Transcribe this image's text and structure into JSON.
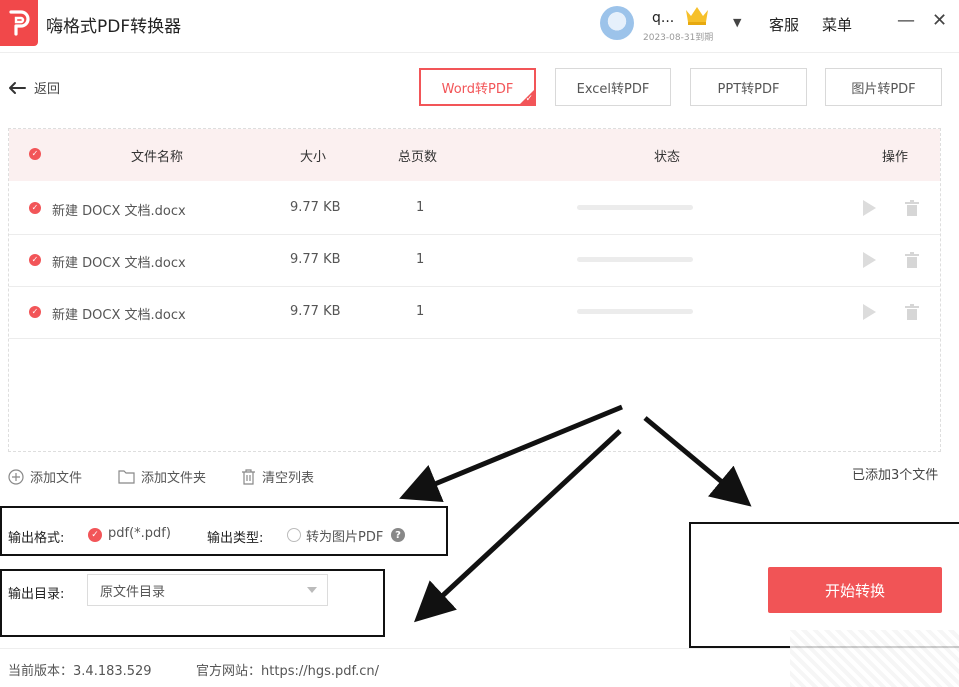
{
  "app": {
    "title": "嗨格式PDF转换器",
    "logo_letter": "P"
  },
  "user": {
    "name": "q...",
    "expiry": "2023-08-31到期"
  },
  "titlebar": {
    "service": "客服",
    "menu": "菜单",
    "minimize": "—",
    "close": "✕"
  },
  "nav": {
    "back": "返回"
  },
  "tabs": [
    {
      "label": "Word转PDF",
      "active": true
    },
    {
      "label": "Excel转PDF",
      "active": false
    },
    {
      "label": "PPT转PDF",
      "active": false
    },
    {
      "label": "图片转PDF",
      "active": false
    }
  ],
  "table": {
    "headers": {
      "name": "文件名称",
      "size": "大小",
      "pages": "总页数",
      "status": "状态",
      "action": "操作"
    },
    "rows": [
      {
        "name": "新建 DOCX 文档.docx",
        "size": "9.77 KB",
        "pages": "1",
        "progress": 0
      },
      {
        "name": "新建 DOCX 文档.docx",
        "size": "9.77 KB",
        "pages": "1",
        "progress": 0
      },
      {
        "name": "新建 DOCX 文档.docx",
        "size": "9.77 KB",
        "pages": "1",
        "progress": 0
      }
    ]
  },
  "toolbar": {
    "add_file": "添加文件",
    "add_folder": "添加文件夹",
    "clear_list": "清空列表",
    "added_count": "已添加3个文件"
  },
  "output": {
    "format_label": "输出格式:",
    "format_value": "pdf(*.pdf)",
    "type_label": "输出类型:",
    "type_option": "转为图片PDF",
    "dir_label": "输出目录:",
    "dir_value": "原文件目录"
  },
  "start_button": "开始转换",
  "footer": {
    "version_label": "当前版本：",
    "version": "3.4.183.529",
    "site_label": "官方网站：",
    "site": "https://hgs.pdf.cn/"
  },
  "colors": {
    "accent": "#f25558",
    "head_bg": "#fbf0f0",
    "annotation": "#111111"
  }
}
